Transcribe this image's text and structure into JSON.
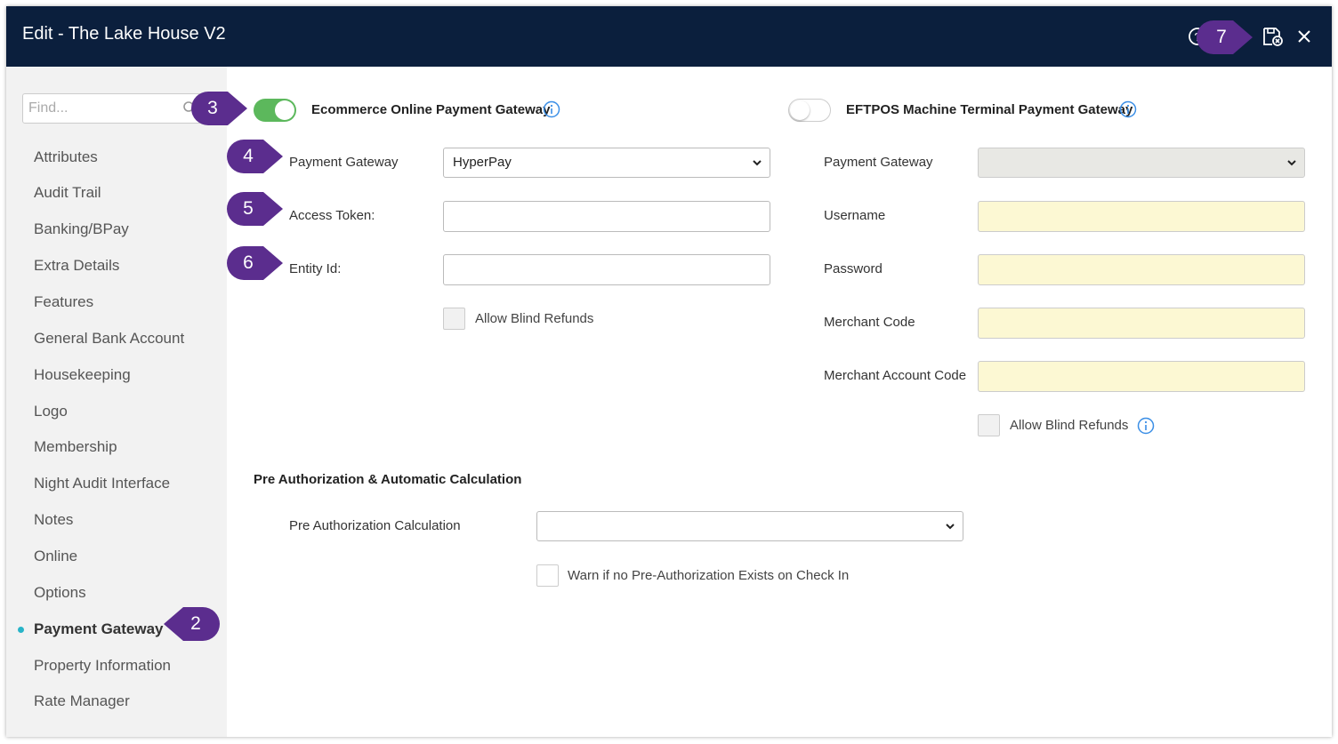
{
  "window": {
    "title": "Edit - The Lake House V2"
  },
  "toolbar": {
    "help_icon": "help-icon",
    "save_icon": "save-close-icon",
    "close_icon": "close-icon"
  },
  "sidebar": {
    "search_placeholder": "Find...",
    "items": [
      {
        "label": "Attributes"
      },
      {
        "label": "Audit Trail"
      },
      {
        "label": "Banking/BPay"
      },
      {
        "label": "Extra Details"
      },
      {
        "label": "Features"
      },
      {
        "label": "General Bank Account"
      },
      {
        "label": "Housekeeping"
      },
      {
        "label": "Logo"
      },
      {
        "label": "Membership"
      },
      {
        "label": "Night Audit Interface"
      },
      {
        "label": "Notes"
      },
      {
        "label": "Online"
      },
      {
        "label": "Options"
      },
      {
        "label": "Payment Gateway",
        "active": true
      },
      {
        "label": "Property Information"
      },
      {
        "label": "Rate Manager"
      }
    ]
  },
  "ecommerce": {
    "heading": "Ecommerce Online Payment Gateway",
    "enabled": true,
    "gateway_label": "Payment Gateway",
    "gateway_value": "HyperPay",
    "access_token_label": "Access Token:",
    "access_token_value": "",
    "entity_id_label": "Entity Id:",
    "entity_id_value": "",
    "allow_blind_refunds_label": "Allow Blind Refunds"
  },
  "eftpos": {
    "heading": "EFTPOS Machine Terminal Payment Gateway",
    "enabled": false,
    "gateway_label": "Payment Gateway",
    "gateway_value": "",
    "username_label": "Username",
    "password_label": "Password",
    "merchant_code_label": "Merchant Code",
    "merchant_account_code_label": "Merchant Account Code",
    "allow_blind_refunds_label": "Allow Blind Refunds"
  },
  "preauth": {
    "heading": "Pre Authorization & Automatic Calculation",
    "calc_label": "Pre Authorization Calculation",
    "calc_value": "",
    "warn_label": "Warn if no Pre-Authorization Exists on Check In"
  },
  "callouts": {
    "c2": "2",
    "c3": "3",
    "c4": "4",
    "c5": "5",
    "c6": "6",
    "c7": "7"
  },
  "colors": {
    "titlebar": "#0b1f3d",
    "callout": "#5b2d8e",
    "toggle_on": "#5cb85c",
    "required_field": "#fcf8d3",
    "active_dot": "#28b4c8"
  }
}
